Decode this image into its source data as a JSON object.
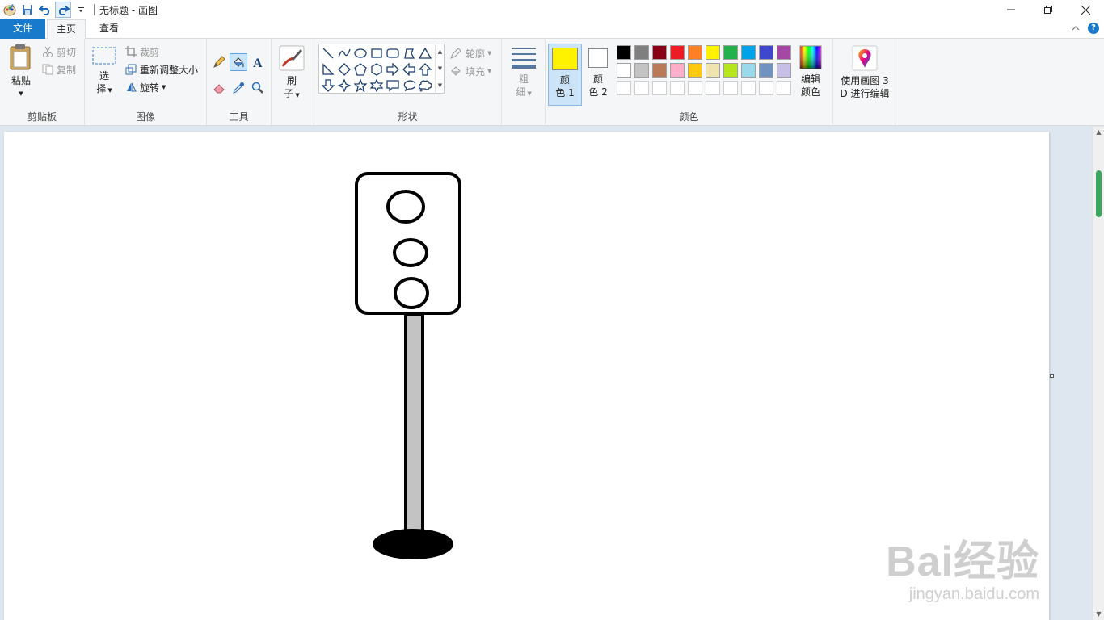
{
  "window": {
    "title": "无标题 - 画图"
  },
  "tabs": {
    "file": "文件",
    "home": "主页",
    "view": "查看"
  },
  "clipboard": {
    "paste": "粘贴",
    "cut": "剪切",
    "copy": "复制",
    "label": "剪贴板"
  },
  "image": {
    "select_line1": "选",
    "select_line2": "择",
    "crop": "裁剪",
    "resize": "重新调整大小",
    "rotate": "旋转",
    "label": "图像"
  },
  "tools": {
    "label": "工具"
  },
  "brushes": {
    "line1": "刷",
    "line2": "子"
  },
  "shapes": {
    "outline": "轮廓",
    "fill": "填充",
    "label": "形状"
  },
  "size": {
    "line1": "粗",
    "line2": "细"
  },
  "colors": {
    "color1_line1": "颜",
    "color1_line2": "色 1",
    "color2_line1": "颜",
    "color2_line2": "色 2",
    "edit_line1": "编辑",
    "edit_line2": "颜色",
    "label": "颜色",
    "color1": "#fff200",
    "color2": "#ffffff",
    "palette_row1": [
      "#000000",
      "#7f7f7f",
      "#880015",
      "#ed1c24",
      "#ff7f27",
      "#fff200",
      "#22b14c",
      "#00a2e8",
      "#3f48cc",
      "#a349a4"
    ],
    "palette_row2": [
      "#ffffff",
      "#c3c3c3",
      "#b97a57",
      "#ffaec9",
      "#ffc90e",
      "#efe4b0",
      "#b5e61d",
      "#99d9ea",
      "#7092be",
      "#c8bfe7"
    ],
    "palette_row3": [
      "#ffffff",
      "#ffffff",
      "#ffffff",
      "#ffffff",
      "#ffffff",
      "#ffffff",
      "#ffffff",
      "#ffffff",
      "#ffffff",
      "#ffffff"
    ]
  },
  "paint3d": {
    "line1": "使用画图 3",
    "line2": "D 进行编辑"
  },
  "watermark": {
    "main": "Bai经验",
    "sub": "jingyan.baidu.com"
  }
}
